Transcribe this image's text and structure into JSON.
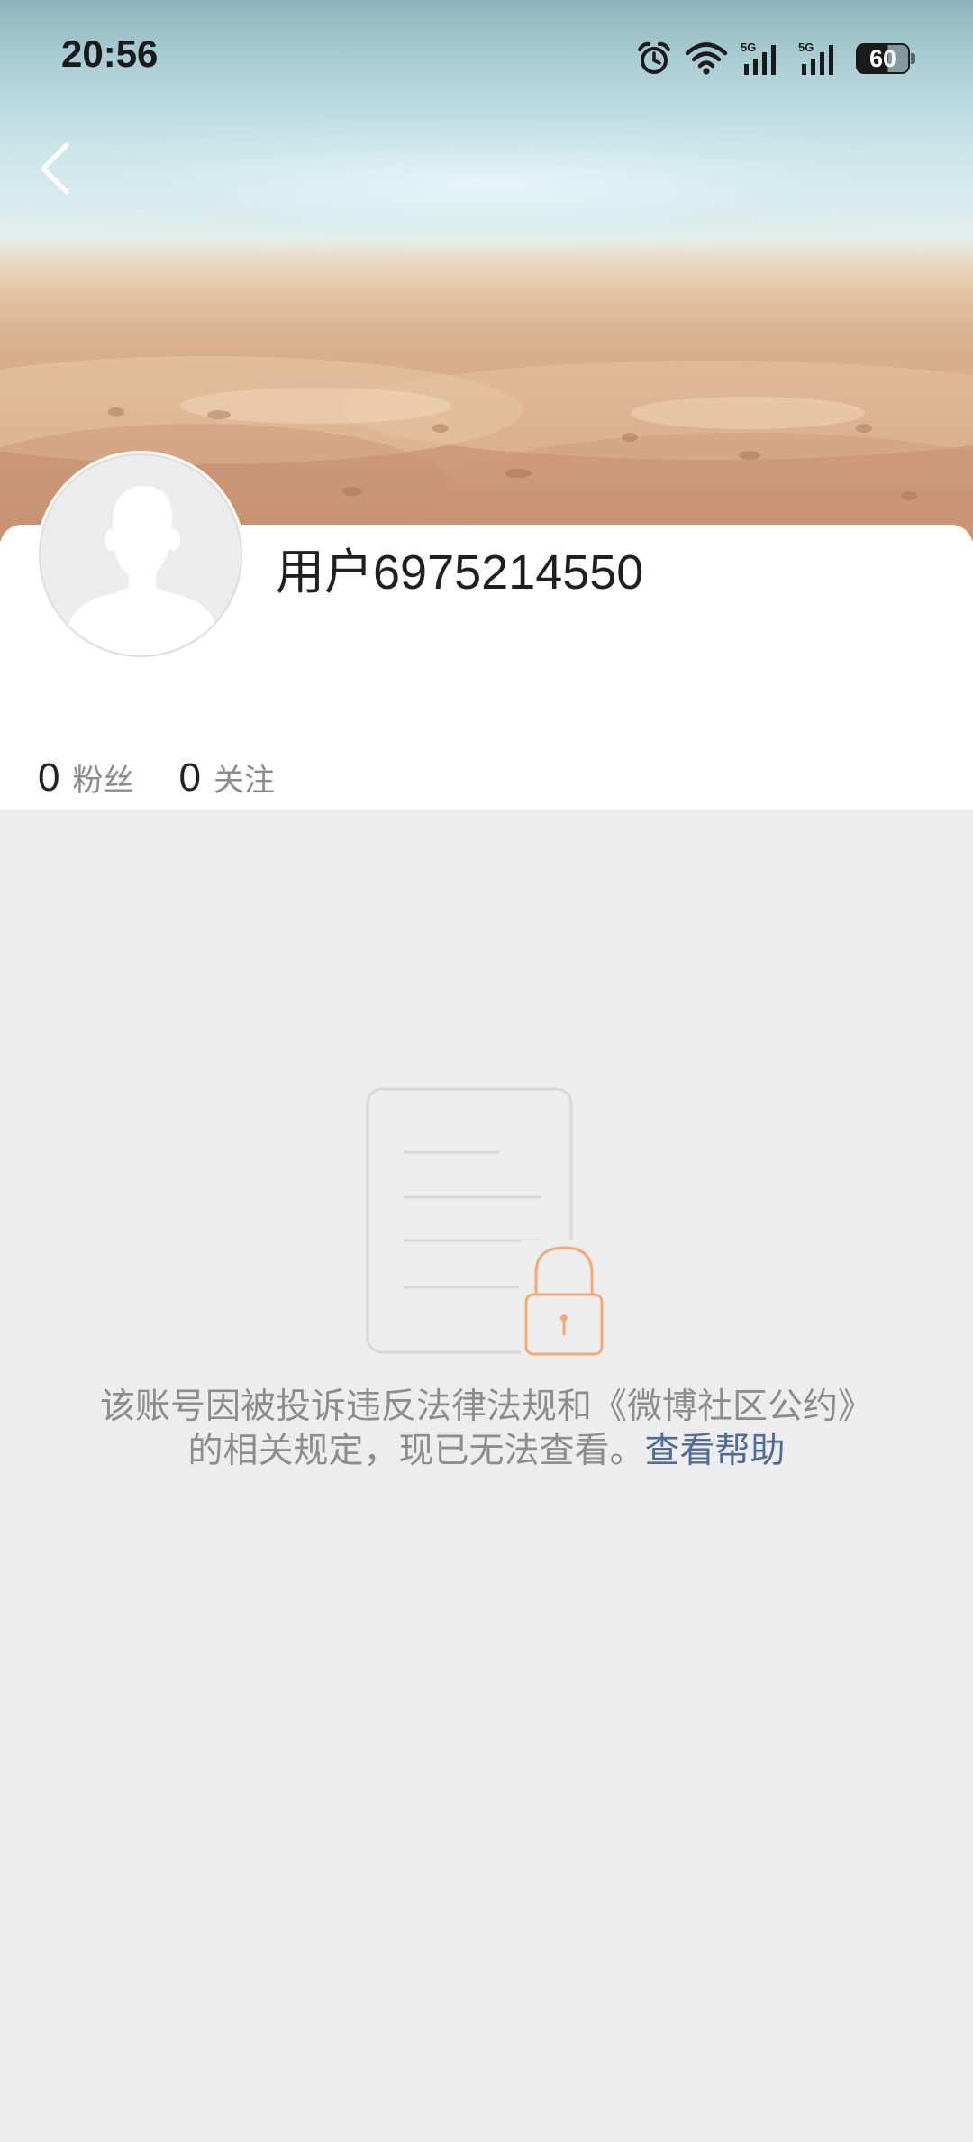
{
  "status_bar": {
    "time": "20:56",
    "battery_level": "60",
    "network_labels": [
      "5G",
      "5G"
    ],
    "icons": [
      "alarm-icon",
      "wifi-icon",
      "signal-5g-icon",
      "signal-5g-icon",
      "battery-icon"
    ]
  },
  "header": {
    "back_icon": "chevron-left-icon",
    "banner_image": "beach-sand-banner"
  },
  "profile": {
    "username": "用户6975214550",
    "avatar": "default-avatar-silhouette",
    "stats": [
      {
        "count": "0",
        "label": "粉丝"
      },
      {
        "count": "0",
        "label": "关注"
      }
    ]
  },
  "notice": {
    "icon": "locked-document-icon",
    "message": "该账号因被投诉违反法律法规和《微博社区公约》的相关规定，现已无法查看。",
    "help_link": "查看帮助"
  },
  "colors": {
    "page_background": "#ededed",
    "link": "#506b99",
    "lock_accent": "#f5a873",
    "muted_text": "#8d8d8d"
  }
}
